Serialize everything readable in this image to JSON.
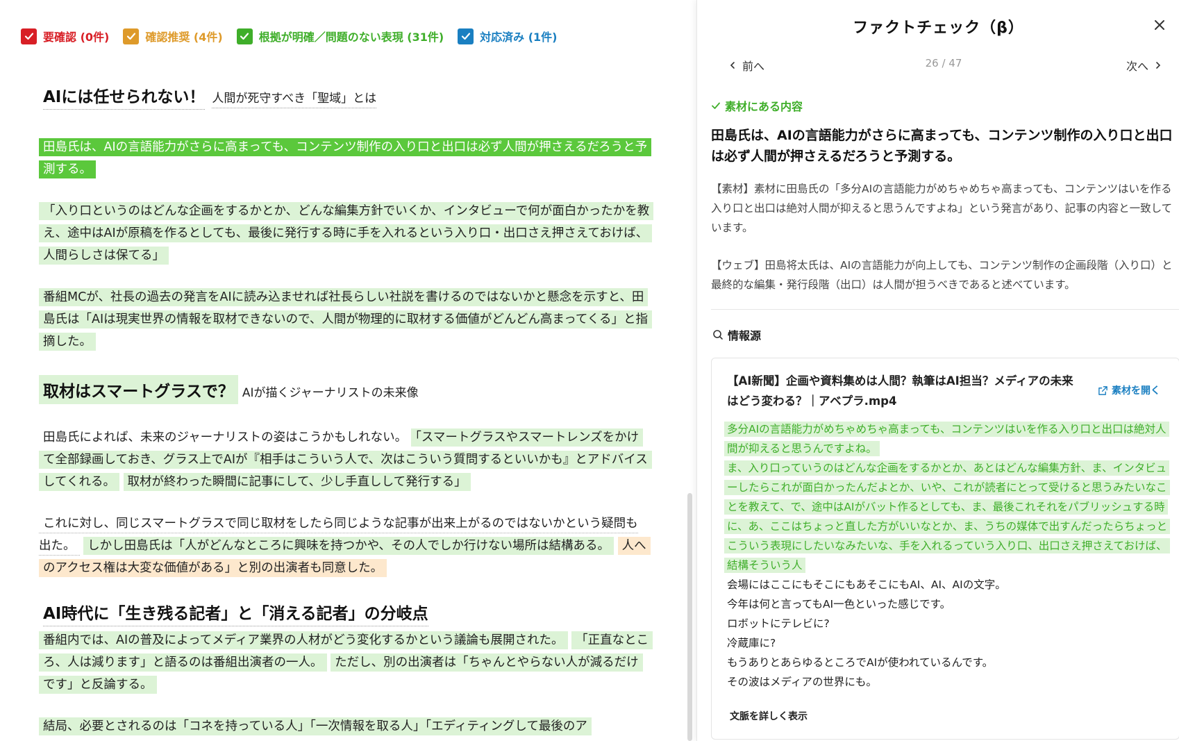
{
  "filters": [
    {
      "label": "要確認 (0件)",
      "color": "#d81f26"
    },
    {
      "label": "確認推奨 (4件)",
      "color": "#de9a2a"
    },
    {
      "label": "根拠が明確／問題のない表現 (31件)",
      "color": "#3fae2a"
    },
    {
      "label": "対応済み (1件)",
      "color": "#1a7fc1"
    }
  ],
  "article": {
    "h1_main": "AIには任せられない！",
    "h1_sub": "人間が死守すべき「聖域」とは",
    "p1": "田島氏は、AIの言語能力がさらに高まっても、コンテンツ制作の入り口と出口は必ず人間が押さえるだろうと予測する。",
    "p2": "「入り口というのはどんな企画をするかとか、どんな編集方針でいくか、インタビューで何が面白かったかを教え、途中はAIが原稿を作るとしても、最後に発行する時に手を入れるという入り口・出口さえ押さえておけば、人間らしさは保てる」",
    "p3": "番組MCが、社長の過去の発言をAIに読み込ませれば社長らしい社説を書けるのではないかと懸念を示すと、田島氏は「AIは現実世界の情報を取材できないので、人間が物理的に取材する価値がどんどん高まってくる」と指摘した。",
    "h2_main": "取材はスマートグラスで？",
    "h2_sub": "AIが描くジャーナリストの未来像",
    "p4a": "田島氏によれば、未来のジャーナリストの姿はこうかもしれない。",
    "p4b": "「スマートグラスやスマートレンズをかけて全部録画しておき、グラス上でAIが『相手はこういう人で、次はこういう質問するといいかも』とアドバイスしてくれる。",
    "p4c": "取材が終わった瞬間に記事にして、少し手直しして発行する」",
    "p5a": "これに対し、同じスマートグラスで同じ取材をしたら同じような記事が出来上がるのではないかという疑問も出た。",
    "p5b": "しかし田島氏は「人がどんなところに興味を持つかや、その人でしか行けない場所は結構ある。",
    "p5c": "人へのアクセス権は大変な価値がある」と別の出演者も同意した。",
    "h3_main": "AI時代に「生き残る記者」と「消える記者」の分岐点",
    "p6a": "番組内では、AIの普及によってメディア業界の人材がどう変化するかという議論も展開された。",
    "p6b": "「正直なところ、人は減ります」と語るのは番組出演者の一人。",
    "p6c": "ただし、別の出演者は「ちゃんとやらない人が減るだけです」と反論する。",
    "p7": "結局、必要とされるのは「コネを持っている人」「一次情報を取る人」「エディティングして最後のア"
  },
  "panel": {
    "title": "ファクトチェック（β）",
    "prev_label": "前へ",
    "next_label": "次へ",
    "pager": "26 / 47",
    "status_label": "素材にある内容",
    "claim": "田島氏は、AIの言語能力がさらに高まっても、コンテンツ制作の入り口と出口は必ず人間が押さえるだろうと予測する。",
    "expl_material": "【素材】素材に田島氏の「多分AIの言語能力がめちゃめちゃ高まっても、コンテンツはいを作る入り口と出口は絶対人間が抑えると思うんですよね」という発言があり、記事の内容と一致しています。",
    "expl_web": "【ウェブ】田島将太氏は、AIの言語能力が向上しても、コンテンツ制作の企画段階（入り口）と最終的な編集・発行段階（出口）は人間が担うべきであると述べています。",
    "sources_heading": "情報源",
    "source_title": "【AI新聞】企画や資料集めは人間？執筆はAI担当？メディアの未来はどう変わる？｜アベプラ.mp4",
    "open_source_label": "素材を開く",
    "transcript_hl_1": "多分AIの言語能力がめちゃめちゃ高まっても、コンテンツはいを作る入り口と出口は絶対人間が抑えると思うんですよね。",
    "transcript_hl_2": "ま、入り口っていうのはどんな企画をするかとか、あとはどんな編集方針、ま、インタビューしたらこれが面白かったんだよとか、いや、これが読者にとって受けると思うみたいなことを教えて、で、途中はAIがバット作るとしても、ま、最後これそれをパブリッシュする時に、あ、ここはちょっと直した方がいいなとか、ま、うちの媒体で出すんだったらちょっとこういう表現にしたいなみたいな、手を入れるっていう入り口、出口さえ押さえておけば、結構そういう人",
    "transcript_lines": [
      "会場にはここにもそこにもあそこにもAI、AI、AIの文字。",
      "今年は何と言ってもAI一色といった感じです。",
      "ロボットにテレビに?",
      "冷蔵庫に?",
      "もうありとあらゆるところでAIが使われているんです。",
      "その波はメディアの世界にも。"
    ],
    "more_context_label": "文脈を詳しく表示"
  },
  "icons": [
    "checkbox-checked-icon",
    "close-icon",
    "chevron-left-icon",
    "chevron-right-icon",
    "check-icon",
    "search-icon",
    "external-link-icon"
  ]
}
